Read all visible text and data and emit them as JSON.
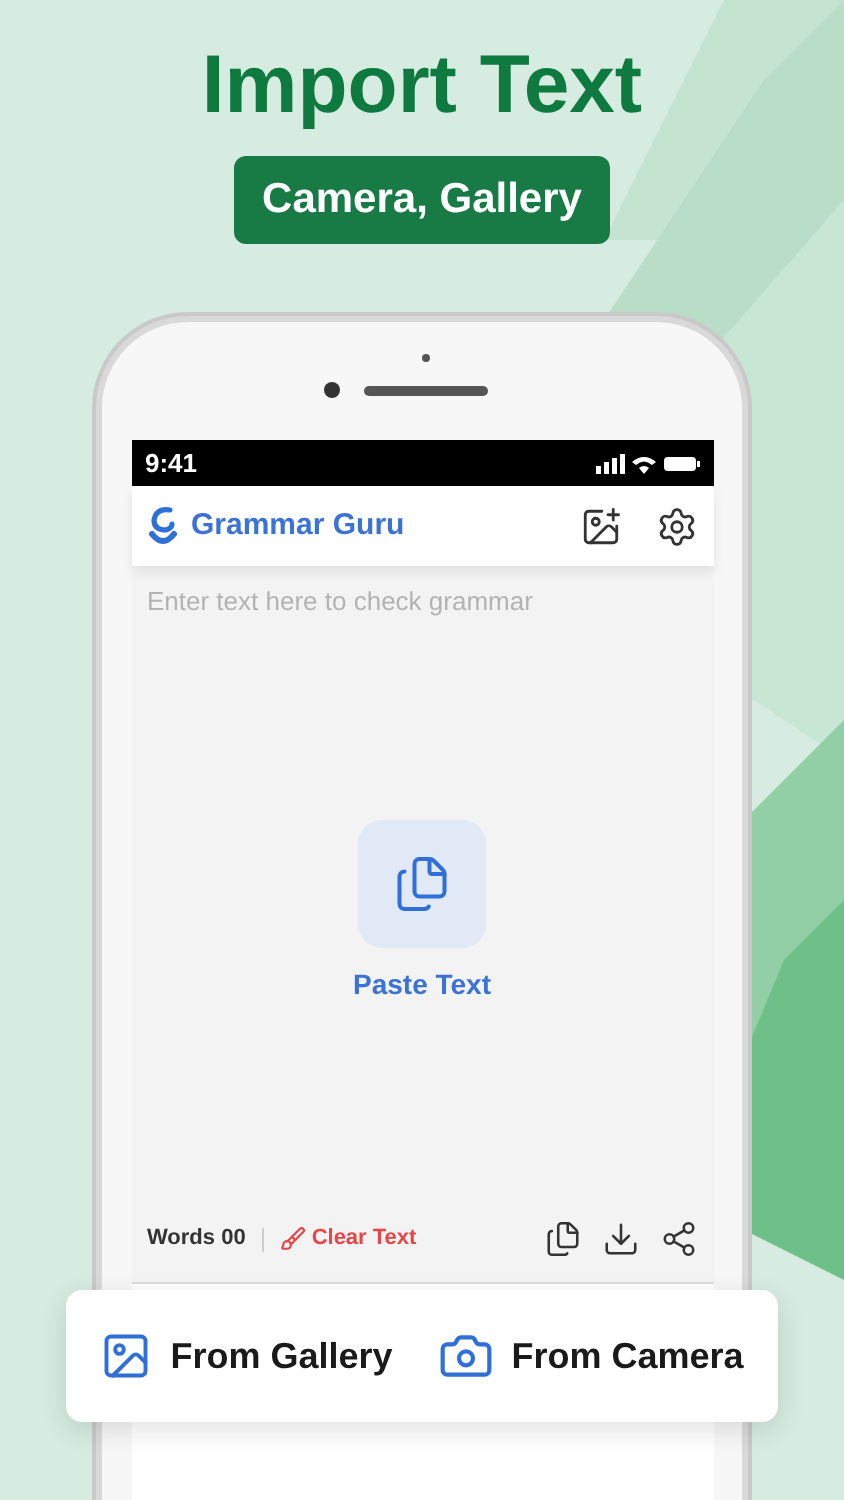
{
  "headline": "Import Text",
  "subtitle": "Camera, Gallery",
  "status_bar": {
    "time": "9:41"
  },
  "app_bar": {
    "title": "Grammar Guru"
  },
  "editor": {
    "placeholder": "Enter text here to check grammar",
    "paste_button": {
      "label": "Paste Text"
    }
  },
  "footer": {
    "word_count": "Words 00",
    "clear_button": {
      "label": "Clear Text"
    }
  },
  "import_options": [
    {
      "kind": "gallery",
      "label": "From Gallery"
    },
    {
      "kind": "camera",
      "label": "From Camera"
    }
  ]
}
